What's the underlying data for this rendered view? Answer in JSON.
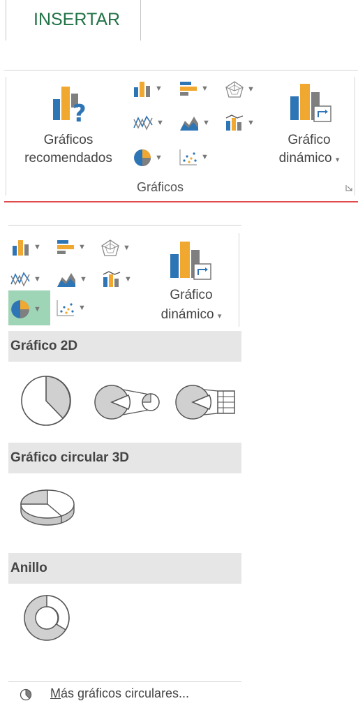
{
  "tab": {
    "label": "INSERTAR"
  },
  "ribbon": {
    "recommended_label_1": "Gráficos",
    "recommended_label_2": "recomendados",
    "pivot_label_1": "Gráfico",
    "pivot_label_2": "dinámico",
    "group_label": "Gráficos",
    "caret": "▾"
  },
  "panel": {
    "pivot_label_1": "Gráfico",
    "pivot_label_2": "dinámico",
    "caret": "▾",
    "sections": [
      {
        "title": "Gráfico 2D"
      },
      {
        "title": "Gráfico circular 3D"
      },
      {
        "title": "Anillo"
      }
    ],
    "more_link_underlined": "M",
    "more_link_rest": "ás gráficos circulares..."
  },
  "colors": {
    "accent_green": "#217346",
    "ribbon_bottom": "#e14b4b",
    "selected_bg": "#9fd5b7",
    "section_bg": "#e6e6e6",
    "chart_blue": "#2e75b6",
    "chart_orange": "#f0a830",
    "chart_gray": "#7f7f7f"
  },
  "icons": [
    "column-chart-icon",
    "bar-chart-icon",
    "radar-chart-icon",
    "line-chart-icon",
    "area-chart-icon",
    "combo-chart-icon",
    "pie-chart-icon",
    "scatter-chart-icon",
    "recommended-charts-icon",
    "pivot-chart-icon",
    "pie-2d-icon",
    "pie-of-pie-icon",
    "bar-of-pie-icon",
    "pie-3d-icon",
    "doughnut-icon",
    "more-pie-icon"
  ]
}
